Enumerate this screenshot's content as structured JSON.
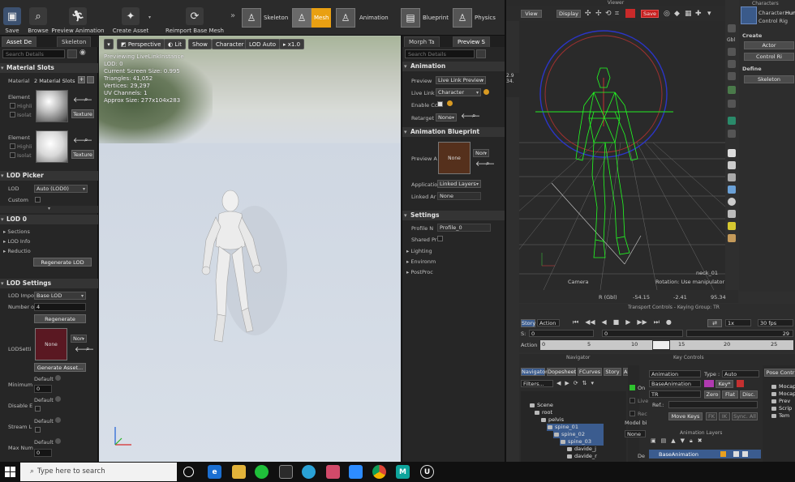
{
  "ue": {
    "toolbar": {
      "save": "Save",
      "browse": "Browse",
      "preview_animation": "Preview Animation",
      "create_asset": "Create Asset",
      "reimport": "Reimport Base Mesh",
      "modes": [
        "Skeleton",
        "Mesh",
        "Animation",
        "Blueprint",
        "Physics"
      ]
    },
    "left": {
      "tabs": [
        "Asset De",
        "Skeleton"
      ],
      "search_placeholder": "Search Details",
      "material_slots": {
        "header": "Material Slots",
        "material_label": "Material",
        "slots_count": "2 Material Slots",
        "element_label": "Element",
        "highlight": "Highli",
        "isolate": "Isolat",
        "texture_btn": "Texture"
      },
      "lod_picker": {
        "header": "LOD Picker",
        "lod_label": "LOD",
        "lod_value": "Auto (LOD0)",
        "custom_label": "Custom"
      },
      "lod0": {
        "header": "LOD 0",
        "items": [
          "Sections",
          "LOD Info",
          "Reductio"
        ],
        "regen_btn": "Regenerate LOD"
      },
      "lod_settings": {
        "header": "LOD Settings",
        "lod_import_label": "LOD Impo",
        "lod_import_value": "Base LOD",
        "number_label": "Number o",
        "number_value": "4",
        "regenerate_btn": "Regenerate",
        "lod_settings_label": "LODSetti",
        "none_label": "None",
        "none_combo": "Non",
        "generate_btn": "Generate Asset...",
        "default_label": "Default",
        "minimum_label": "Minimum",
        "disable_label": "Disable E",
        "stream_label": "Stream L",
        "maxnum_label": "Max Num",
        "zero": "0"
      }
    },
    "viewport": {
      "perspective": "Perspective",
      "lit": "Lit",
      "show": "Show",
      "character": "Character",
      "lod_auto": "LOD Auto",
      "speed": "x1.0",
      "stats": [
        "Previewing LiveLinkInstance",
        "LOD: 0",
        "Current Screen Size: 0.995",
        "Triangles: 41,052",
        "Vertices: 29,297",
        "UV Channels: 1",
        "Approx Size: 277x104x283"
      ]
    },
    "right": {
      "tabs": [
        "Morph Ta",
        "Preview S"
      ],
      "search_placeholder": "Search Details",
      "animation_header": "Animation",
      "preview_label": "Preview",
      "preview_value": "Live Link Preview",
      "livelink_label": "Live Link",
      "livelink_value": "Character",
      "enable_label": "Enable Cc",
      "retarget_label": "Retarget",
      "retarget_value": "None",
      "anim_bp_header": "Animation Blueprint",
      "preview_a_label": "Preview A",
      "none_label": "None",
      "none_combo": "Non",
      "application_label": "Applicatio",
      "application_value": "Linked Layers",
      "linked_label": "Linked Ar",
      "linked_value": "None",
      "settings_header": "Settings",
      "profile_label": "Profile N",
      "profile_value": "Profile_0",
      "shared_label": "Shared Pr",
      "collapsed": [
        "Lighting",
        "Environm",
        "PostProc"
      ]
    }
  },
  "mb": {
    "viewer_title": "Viewer",
    "view_btn": "View",
    "display_btn": "Display",
    "save_btn": "Save",
    "readout_left_1": "2.9",
    "readout_left_2": "34.",
    "neck_label": "neck_01",
    "camera_label": "Camera",
    "rotation_label": "Rotation: Use manipulator",
    "r_label": "R (Gbl)",
    "r_x": "-54.15",
    "r_y": "-2.41",
    "r_z": "95.34",
    "character_panel": {
      "title": "Characters",
      "character_label": "Character:",
      "character_value": "Human",
      "control_label": "Control Rig",
      "create_header": "Create",
      "actor_btn": "Actor",
      "control_rig_btn": "Control Ri",
      "define_header": "Define",
      "skeleton_btn": "Skeleton"
    },
    "toolstrip_label": "Gbl",
    "transport": {
      "title": "Transport Controls  -  Keying Group: TR",
      "story_btn": "Story",
      "action_combo": "Action",
      "speed": "1x",
      "fps": "30 fps",
      "s_label": "S:",
      "start_value": "0",
      "cur_value": "0",
      "end_value": "29",
      "action_label": "Action",
      "ticks": [
        "0",
        "5",
        "10",
        "15",
        "20",
        "25"
      ]
    },
    "navigator": {
      "title": "Navigator",
      "tabs": [
        "Navigator",
        "Dopesheet",
        "FCurves",
        "Story",
        "Anim"
      ],
      "filters": "Filters...",
      "tree": [
        "Scene",
        "root",
        "pelvis",
        "spine_01",
        "spine_02",
        "spine_03",
        "davide_j",
        "davide_r"
      ]
    },
    "keys": {
      "title": "Key Controls",
      "animation_combo": "Animation",
      "type_label": "Type :",
      "type_value": "Auto",
      "base_animation": "BaseAnimation",
      "key_btn": "Key*",
      "tr_combo": "TR",
      "zero_btn": "Zero",
      "flat_btn": "Flat",
      "disc_btn": "Disc.",
      "ref_label": "Ref.:",
      "move_keys_btn": "Move Keys",
      "fk_btn": "FK",
      "ik_btn": "IK",
      "sync_btn": "Sync. All",
      "on_label": "On",
      "live_label": "Live",
      "rec_label": "Rec",
      "model_label": "Model bi",
      "none_label": "None",
      "de_label": "De",
      "anim_layers_title": "Animation Layers",
      "base_layer": "BaseAnimation"
    },
    "pose": {
      "header": "Pose Contr",
      "items": [
        "Mocap",
        "Mocap",
        "Prev",
        "Scrip",
        "Tem"
      ]
    }
  },
  "taskbar": {
    "search_placeholder": "Type here to search"
  },
  "colors": {
    "ue_accent": "#e9a012",
    "mb_wire": "#22ff22",
    "mb_save": "#c81e1e",
    "mb_selection": "#3b5c8f"
  }
}
